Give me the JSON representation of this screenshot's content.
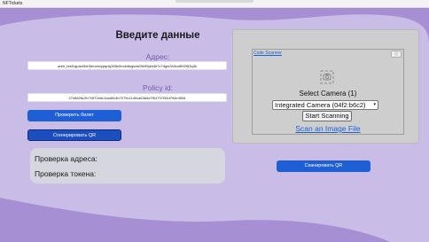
{
  "window": {
    "title": "NFTickets"
  },
  "verify": {
    "heading": "Введите данные",
    "address_label": "Адрес:",
    "address_value": "addr_test1qpam3dr3dmxsnypqnkj305s9mdx6sgsza09h55jztx8r7c7dgrs3h3cx8t92t53q3k",
    "policy_label": "Policy id:",
    "policy_value": "2748826c2b7f4f72b6c1dad0c4b7079c11d0ca63a4d7f04797f34d794e4554",
    "check_button": "Проверить билет",
    "generate_button": "Сгенерировать QR"
  },
  "status": {
    "address_check": "Проверка адреса:",
    "token_check": "Проверка токена:"
  },
  "scanner": {
    "link": "Code Scanner",
    "info_button": "ⓘ",
    "camera_icon": "camera-icon",
    "select_label": "Select Camera (1)",
    "selected_camera": "Integrated Camera (04f2:b6c2)",
    "start_button": "Start Scanning",
    "file_link": "Scan an Image File",
    "scan_button": "Сканировать QR"
  },
  "colors": {
    "background": "#a78fd3",
    "blob": "#c9bde8",
    "accent_label": "#6f5aa8",
    "button_blue": "#1f5fd6",
    "link_blue": "#1d5fd4",
    "panel_gray": "#cecece"
  }
}
